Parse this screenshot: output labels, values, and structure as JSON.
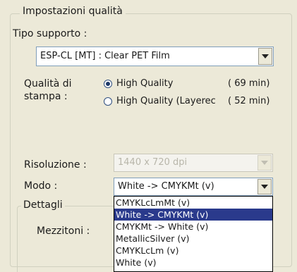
{
  "group": {
    "title": "Impostazioni qualità"
  },
  "media_type": {
    "label": "Tipo supporto :",
    "value": "ESP-CL [MT] : Clear PET Film"
  },
  "print_quality": {
    "label_line1": "Qualità di",
    "label_line2": "stampa :",
    "options": [
      {
        "label": "High Quality",
        "time": "( 69 min)",
        "selected": true
      },
      {
        "label": "High Quality (Layerec",
        "time": "( 52 min)",
        "selected": false
      }
    ]
  },
  "resolution": {
    "label": "Risoluzione :",
    "value": "1440 x 720 dpi",
    "disabled": true
  },
  "mode": {
    "label": "Modo :",
    "value": "White -> CMYKMt (v)",
    "options": [
      {
        "label": "CMYKLcLmMt (v)",
        "selected": false
      },
      {
        "label": "White -> CMYKMt (v)",
        "selected": true
      },
      {
        "label": "CMYKMt -> White (v)",
        "selected": false
      },
      {
        "label": "MetallicSilver (v)",
        "selected": false
      },
      {
        "label": "CMYKLcLm (v)",
        "selected": false
      },
      {
        "label": "White (v)",
        "selected": false
      }
    ]
  },
  "details": {
    "title": "Dettagli",
    "halftone_label": "Mezzitoni :"
  }
}
